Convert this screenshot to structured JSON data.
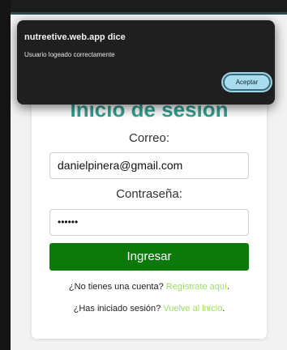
{
  "alert": {
    "origin": "nutreetive.web.app dice",
    "message": "Usuario logeado correctamente",
    "accept_label": "Aceptar"
  },
  "login": {
    "title": "Inicio de sesión",
    "email_label": "Correo:",
    "email_value": "danielpinera@gmail.com",
    "password_label": "Contraseña:",
    "password_value": "••••••",
    "submit_label": "Ingresar",
    "register_prompt": "¿No tienes una cuenta?",
    "register_link": "Regístrate aquí",
    "register_suffix": ".",
    "signed_in_prompt": "¿Has iniciado sesión?",
    "home_link": "Vuelve al inicio",
    "home_suffix": "."
  }
}
